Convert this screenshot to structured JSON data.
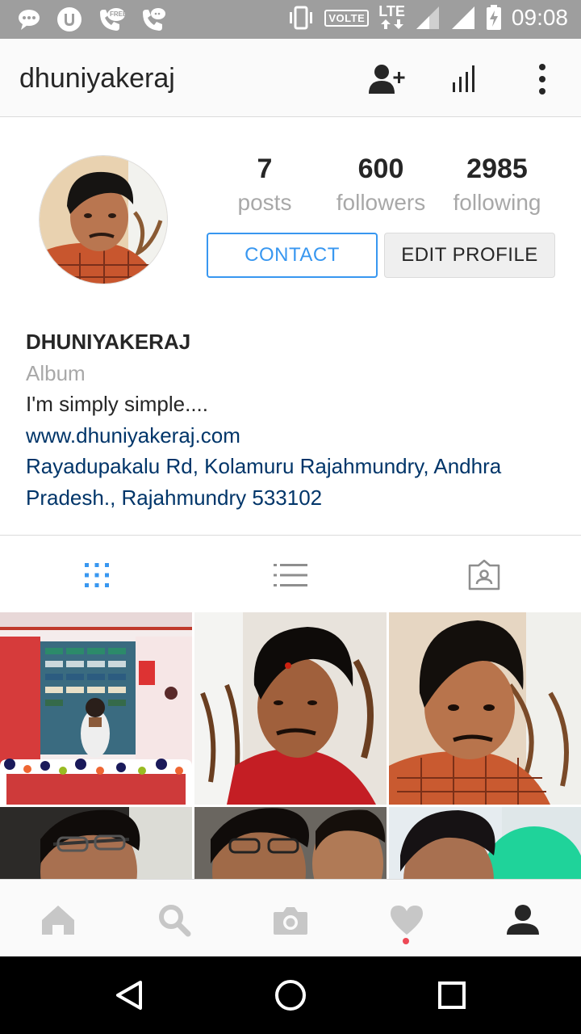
{
  "status_bar": {
    "time": "09:08",
    "volte_label": "VOLTE",
    "lte_label": "LTE",
    "free_label": "FREE",
    "left_icons": [
      "chat-bubble-icon",
      "ucweb-icon",
      "free-call-icon",
      "phone-chat-icon"
    ],
    "right_icons": [
      "vibrate-icon",
      "signal-icon",
      "signal-icon",
      "battery-charging-icon"
    ]
  },
  "header": {
    "username": "dhuniyakeraj",
    "icons": [
      "add-user-icon",
      "insights-icon",
      "more-options-icon"
    ]
  },
  "profile": {
    "stats": [
      {
        "value": "7",
        "label": "posts"
      },
      {
        "value": "600",
        "label": "followers"
      },
      {
        "value": "2985",
        "label": "following"
      }
    ],
    "contact_label": "CONTACT",
    "edit_label": "EDIT PROFILE",
    "name": "DHUNIYAKERAJ",
    "category": "Album",
    "bio": "I'm simply simple....",
    "website": "www.dhuniyakeraj.com",
    "address_line1": "Rayadupakalu Rd, Kolamuru Rajahmundry, Andhra",
    "address_line2": "Pradesh., Rajahmundry 533102"
  },
  "tabs": [
    "grid-view-icon",
    "list-view-icon",
    "tagged-photos-icon"
  ],
  "bottom_nav": [
    "home-icon",
    "search-icon",
    "camera-icon",
    "activity-heart-icon",
    "profile-icon"
  ],
  "system_nav": [
    "back-icon",
    "home-circle-icon",
    "recents-icon"
  ],
  "colors": {
    "accent": "#3897f0",
    "link": "#003569",
    "status_bar": "#9e9e9e",
    "notification_dot": "#ed4956"
  }
}
